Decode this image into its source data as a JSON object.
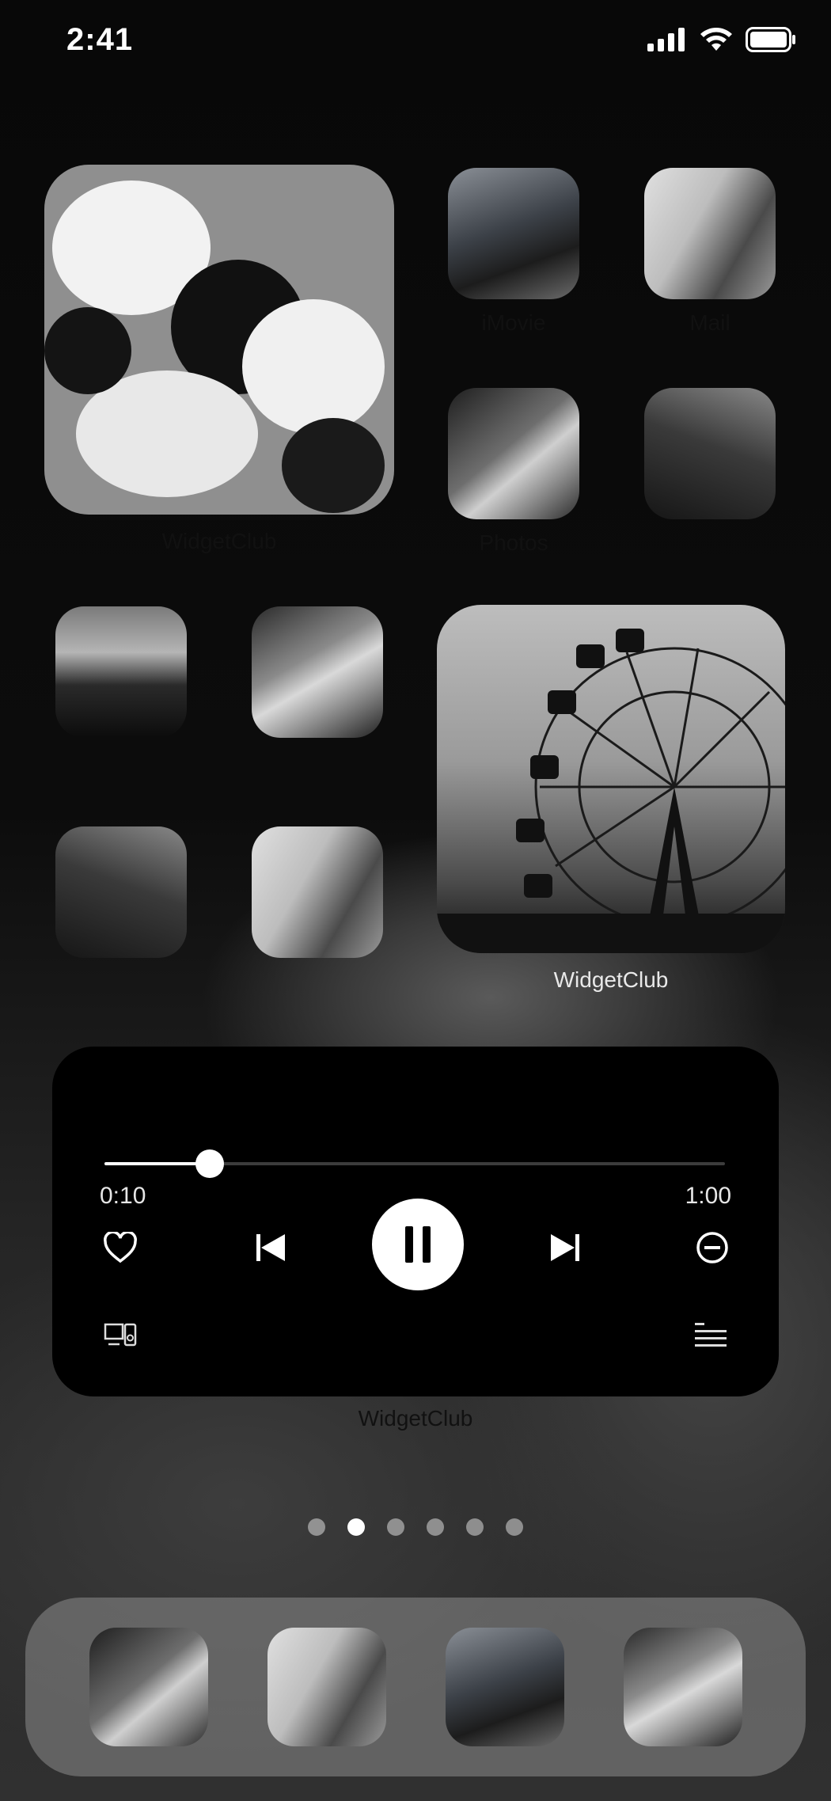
{
  "status_bar": {
    "time": "2:41",
    "icons": [
      "cellular-signal-icon",
      "wifi-icon",
      "battery-icon"
    ]
  },
  "home": {
    "large_widget_1": {
      "label": "WidgetClub"
    },
    "apps_row1": [
      {
        "label": "iMovie"
      },
      {
        "label": "Mail"
      }
    ],
    "apps_row2": [
      {
        "label": "Photos"
      },
      {
        "label": ""
      }
    ],
    "small_grid": [
      {
        "label": ""
      },
      {
        "label": ""
      },
      {
        "label": ""
      },
      {
        "label": ""
      }
    ],
    "large_widget_2": {
      "label": "WidgetClub"
    }
  },
  "music_widget": {
    "label": "WidgetClub",
    "elapsed": "0:10",
    "duration": "1:00",
    "progress": 0.17,
    "icons": {
      "like": "heart-icon",
      "previous": "previous-track-icon",
      "pause": "pause-icon",
      "next": "next-track-icon",
      "remove": "minus-circle-icon",
      "device": "speaker-device-icon",
      "queue": "queue-list-icon"
    }
  },
  "page_dots": {
    "count": 6,
    "active_index": 1
  },
  "dock": {
    "icons": [
      "dock-photo-1",
      "dock-photo-2",
      "dock-photo-3",
      "dock-photo-4"
    ]
  }
}
